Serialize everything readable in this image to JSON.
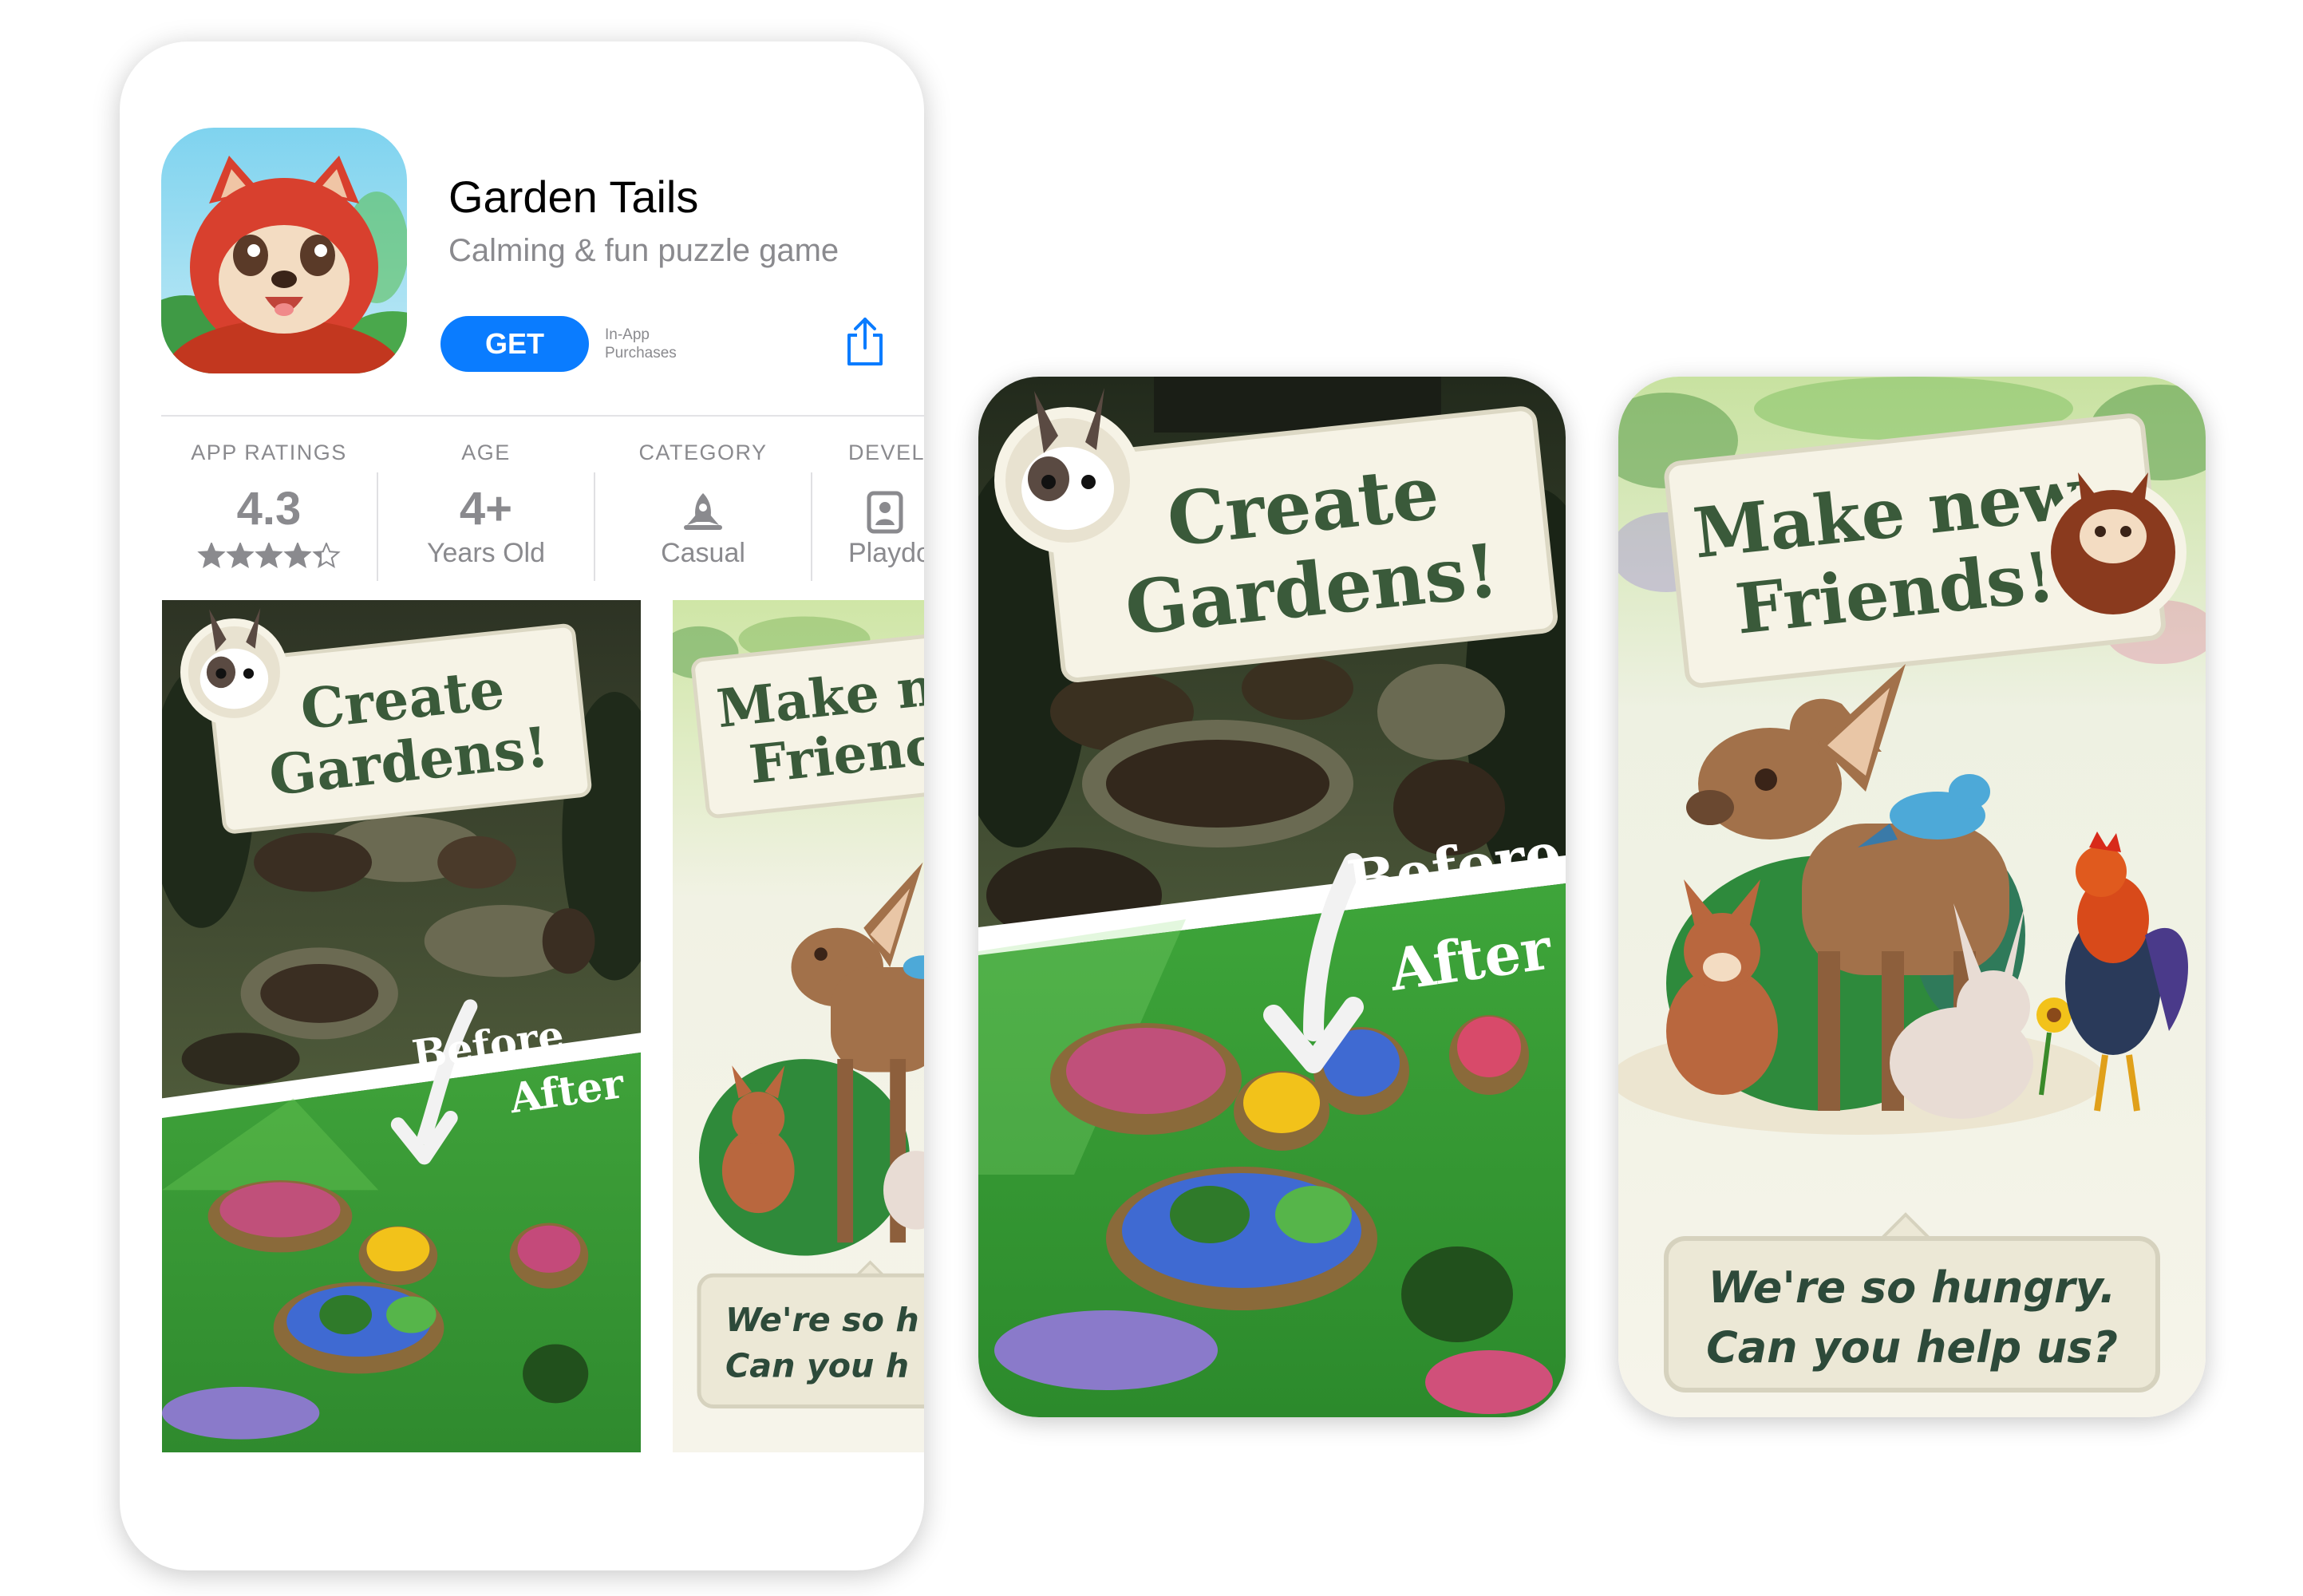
{
  "app": {
    "name": "Garden Tails",
    "subtitle": "Calming & fun puzzle game",
    "get_label": "GET",
    "iap_line1": "In-App",
    "iap_line2": "Purchases"
  },
  "stats": [
    {
      "label": "APP RATINGS",
      "value": "4.3",
      "rating": 4.3,
      "max_stars": 5
    },
    {
      "label": "AGE",
      "value": "4+",
      "sub": "Years Old"
    },
    {
      "label": "CATEGORY",
      "sub": "Casual",
      "icon": "rocket-icon"
    },
    {
      "label": "DEVEL",
      "sub": "Playdo",
      "icon": "developer-icon"
    }
  ],
  "screenshots": {
    "gardens": {
      "title_line1": "Create",
      "title_line2": "Gardens!",
      "before": "Before",
      "after": "After"
    },
    "friends": {
      "title_line1": "Make new",
      "title_line2": "Friends!",
      "speech_line1": "We're so hungry.",
      "speech_line2": "Can you help us?"
    },
    "friends_cropped": {
      "title_line1": "Make n",
      "title_line2": "Frienc",
      "speech_line1": "We're so h",
      "speech_line2": "Can you h"
    }
  },
  "colors": {
    "accent": "#0a7cff",
    "title_green": "#3a5a3a",
    "label_gray": "#8a8a8e",
    "card_cream": "#f6f3e6"
  }
}
